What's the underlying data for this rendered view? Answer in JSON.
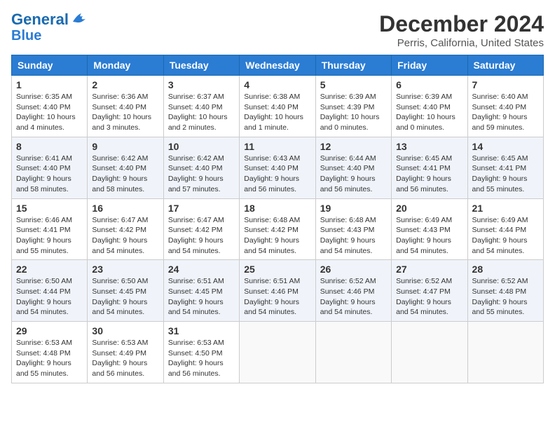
{
  "header": {
    "logo_line1": "General",
    "logo_line2": "Blue",
    "title": "December 2024",
    "subtitle": "Perris, California, United States"
  },
  "columns": [
    "Sunday",
    "Monday",
    "Tuesday",
    "Wednesday",
    "Thursday",
    "Friday",
    "Saturday"
  ],
  "weeks": [
    [
      {
        "day": "1",
        "sunrise": "6:35 AM",
        "sunset": "4:40 PM",
        "daylight": "10 hours and 4 minutes."
      },
      {
        "day": "2",
        "sunrise": "6:36 AM",
        "sunset": "4:40 PM",
        "daylight": "10 hours and 3 minutes."
      },
      {
        "day": "3",
        "sunrise": "6:37 AM",
        "sunset": "4:40 PM",
        "daylight": "10 hours and 2 minutes."
      },
      {
        "day": "4",
        "sunrise": "6:38 AM",
        "sunset": "4:40 PM",
        "daylight": "10 hours and 1 minute."
      },
      {
        "day": "5",
        "sunrise": "6:39 AM",
        "sunset": "4:39 PM",
        "daylight": "10 hours and 0 minutes."
      },
      {
        "day": "6",
        "sunrise": "6:39 AM",
        "sunset": "4:40 PM",
        "daylight": "10 hours and 0 minutes."
      },
      {
        "day": "7",
        "sunrise": "6:40 AM",
        "sunset": "4:40 PM",
        "daylight": "9 hours and 59 minutes."
      }
    ],
    [
      {
        "day": "8",
        "sunrise": "6:41 AM",
        "sunset": "4:40 PM",
        "daylight": "9 hours and 58 minutes."
      },
      {
        "day": "9",
        "sunrise": "6:42 AM",
        "sunset": "4:40 PM",
        "daylight": "9 hours and 58 minutes."
      },
      {
        "day": "10",
        "sunrise": "6:42 AM",
        "sunset": "4:40 PM",
        "daylight": "9 hours and 57 minutes."
      },
      {
        "day": "11",
        "sunrise": "6:43 AM",
        "sunset": "4:40 PM",
        "daylight": "9 hours and 56 minutes."
      },
      {
        "day": "12",
        "sunrise": "6:44 AM",
        "sunset": "4:40 PM",
        "daylight": "9 hours and 56 minutes."
      },
      {
        "day": "13",
        "sunrise": "6:45 AM",
        "sunset": "4:41 PM",
        "daylight": "9 hours and 56 minutes."
      },
      {
        "day": "14",
        "sunrise": "6:45 AM",
        "sunset": "4:41 PM",
        "daylight": "9 hours and 55 minutes."
      }
    ],
    [
      {
        "day": "15",
        "sunrise": "6:46 AM",
        "sunset": "4:41 PM",
        "daylight": "9 hours and 55 minutes."
      },
      {
        "day": "16",
        "sunrise": "6:47 AM",
        "sunset": "4:42 PM",
        "daylight": "9 hours and 54 minutes."
      },
      {
        "day": "17",
        "sunrise": "6:47 AM",
        "sunset": "4:42 PM",
        "daylight": "9 hours and 54 minutes."
      },
      {
        "day": "18",
        "sunrise": "6:48 AM",
        "sunset": "4:42 PM",
        "daylight": "9 hours and 54 minutes."
      },
      {
        "day": "19",
        "sunrise": "6:48 AM",
        "sunset": "4:43 PM",
        "daylight": "9 hours and 54 minutes."
      },
      {
        "day": "20",
        "sunrise": "6:49 AM",
        "sunset": "4:43 PM",
        "daylight": "9 hours and 54 minutes."
      },
      {
        "day": "21",
        "sunrise": "6:49 AM",
        "sunset": "4:44 PM",
        "daylight": "9 hours and 54 minutes."
      }
    ],
    [
      {
        "day": "22",
        "sunrise": "6:50 AM",
        "sunset": "4:44 PM",
        "daylight": "9 hours and 54 minutes."
      },
      {
        "day": "23",
        "sunrise": "6:50 AM",
        "sunset": "4:45 PM",
        "daylight": "9 hours and 54 minutes."
      },
      {
        "day": "24",
        "sunrise": "6:51 AM",
        "sunset": "4:45 PM",
        "daylight": "9 hours and 54 minutes."
      },
      {
        "day": "25",
        "sunrise": "6:51 AM",
        "sunset": "4:46 PM",
        "daylight": "9 hours and 54 minutes."
      },
      {
        "day": "26",
        "sunrise": "6:52 AM",
        "sunset": "4:46 PM",
        "daylight": "9 hours and 54 minutes."
      },
      {
        "day": "27",
        "sunrise": "6:52 AM",
        "sunset": "4:47 PM",
        "daylight": "9 hours and 54 minutes."
      },
      {
        "day": "28",
        "sunrise": "6:52 AM",
        "sunset": "4:48 PM",
        "daylight": "9 hours and 55 minutes."
      }
    ],
    [
      {
        "day": "29",
        "sunrise": "6:53 AM",
        "sunset": "4:48 PM",
        "daylight": "9 hours and 55 minutes."
      },
      {
        "day": "30",
        "sunrise": "6:53 AM",
        "sunset": "4:49 PM",
        "daylight": "9 hours and 56 minutes."
      },
      {
        "day": "31",
        "sunrise": "6:53 AM",
        "sunset": "4:50 PM",
        "daylight": "9 hours and 56 minutes."
      },
      null,
      null,
      null,
      null
    ]
  ],
  "labels": {
    "sunrise": "Sunrise:",
    "sunset": "Sunset:",
    "daylight": "Daylight:"
  }
}
